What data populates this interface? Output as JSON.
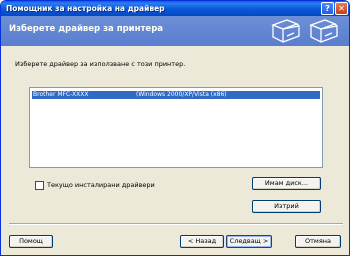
{
  "window": {
    "title": "Помощник за настройка на драйвер",
    "help_glyph": "?",
    "close_glyph": "✕"
  },
  "header": {
    "title": "Изберете драйвер за принтера",
    "icons": [
      "printer-icon",
      "printer-icon"
    ]
  },
  "main": {
    "instruction": "Изберете драйвер за използване с този принтер.",
    "drivers": [
      {
        "model": "Brother MFC-XXXX",
        "os": "(Windows 2000/XP/Vista (x86)",
        "selected": true
      }
    ],
    "show_installed_label": "Текущо инсталирани драйвери",
    "show_installed_checked": false,
    "have_disk_button": "Имам диск...",
    "delete_button": "Изтрий"
  },
  "footer": {
    "help_button": "Помощ",
    "back_button": "< Назад",
    "next_button": "Следващ >",
    "cancel_button": "Отмяна"
  },
  "colors": {
    "title_bar": "#0a57d8",
    "header_band": "#6483d3",
    "dialog_face": "#ece9d8",
    "selection": "#316ac5"
  }
}
